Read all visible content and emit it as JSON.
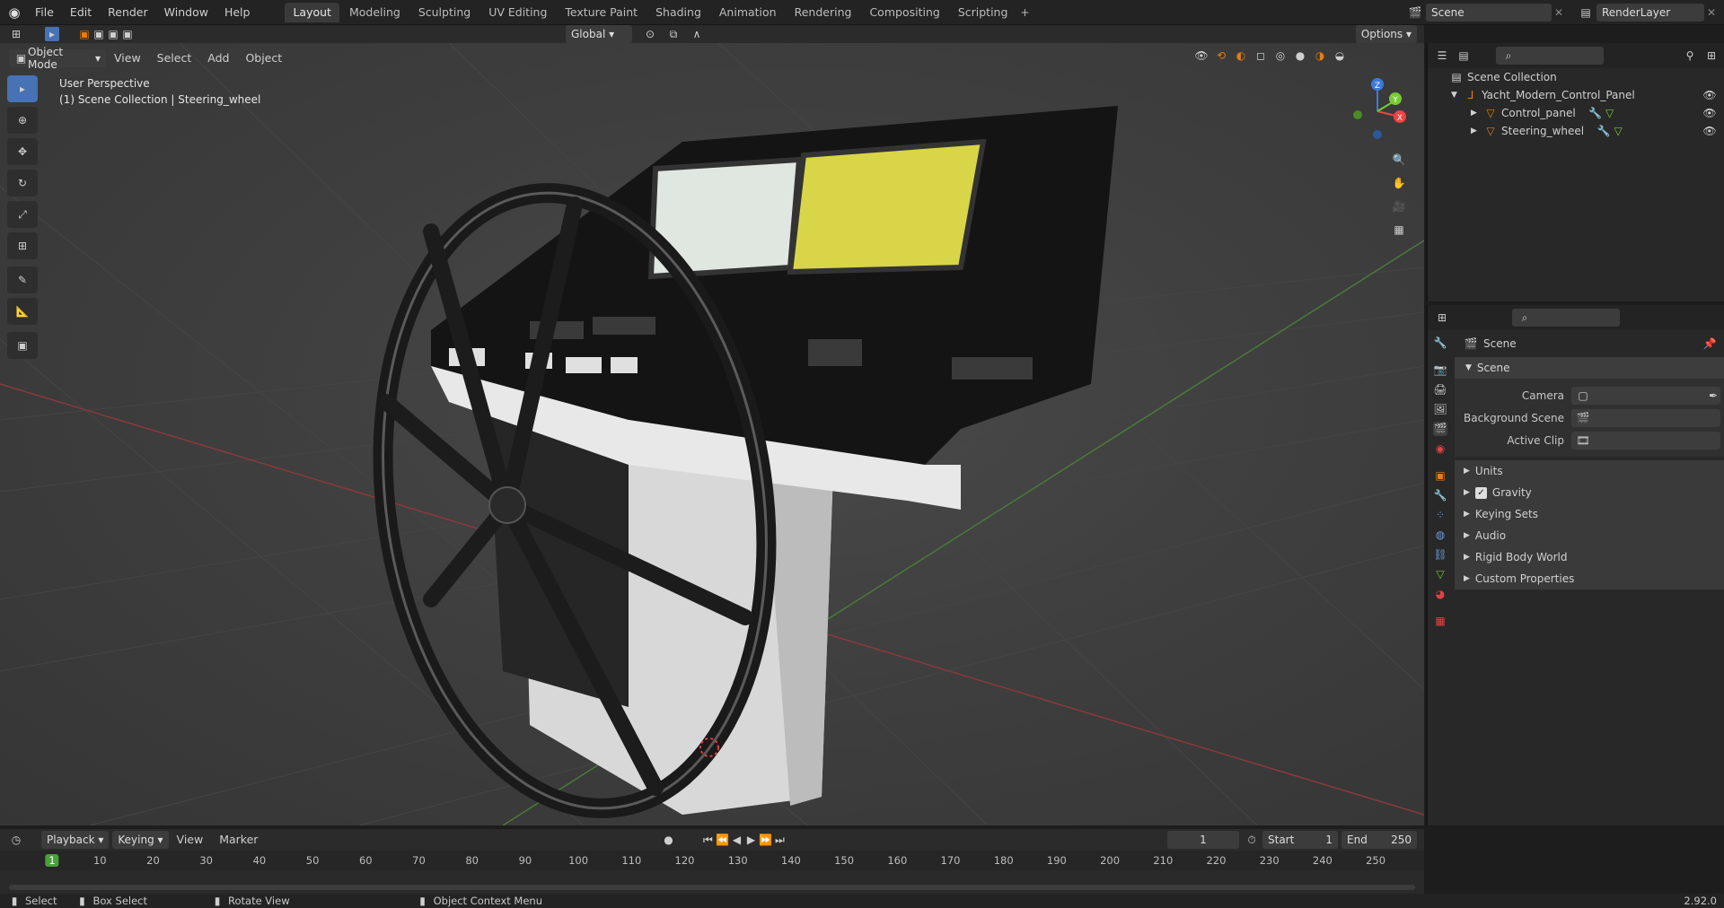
{
  "app": {
    "logo": "blender-logo-icon"
  },
  "menus": [
    "File",
    "Edit",
    "Render",
    "Window",
    "Help"
  ],
  "workspaces": [
    {
      "label": "Layout",
      "active": true
    },
    {
      "label": "Modeling",
      "active": false
    },
    {
      "label": "Sculpting",
      "active": false
    },
    {
      "label": "UV Editing",
      "active": false
    },
    {
      "label": "Texture Paint",
      "active": false
    },
    {
      "label": "Shading",
      "active": false
    },
    {
      "label": "Animation",
      "active": false
    },
    {
      "label": "Rendering",
      "active": false
    },
    {
      "label": "Compositing",
      "active": false
    },
    {
      "label": "Scripting",
      "active": false
    }
  ],
  "topright": {
    "scene": "Scene",
    "render_layer": "RenderLayer"
  },
  "viewport": {
    "mode": "Object Mode",
    "menus": [
      "View",
      "Select",
      "Add",
      "Object"
    ],
    "orientation": "Global",
    "options_label": "Options",
    "overlay_title": "User Perspective",
    "overlay_subtitle": "(1) Scene Collection | Steering_wheel",
    "gizmo": {
      "x": "X",
      "y": "Y",
      "z": "Z"
    }
  },
  "outliner": {
    "root": "Scene Collection",
    "items": [
      {
        "label": "Yacht_Modern_Control_Panel",
        "depth": 1
      },
      {
        "label": "Control_panel",
        "depth": 2
      },
      {
        "label": "Steering_wheel",
        "depth": 2
      }
    ]
  },
  "properties": {
    "header": "Scene",
    "section": "Scene",
    "fields": [
      {
        "label": "Camera"
      },
      {
        "label": "Background Scene"
      },
      {
        "label": "Active Clip"
      }
    ],
    "panels": [
      "Units",
      "Gravity",
      "Keying Sets",
      "Audio",
      "Rigid Body World",
      "Custom Properties"
    ]
  },
  "timeline": {
    "menus": [
      "Playback",
      "Keying",
      "View",
      "Marker"
    ],
    "current_frame": "1",
    "start_label": "Start",
    "start": "1",
    "end_label": "End",
    "end": "250",
    "ticks": [
      "1",
      "10",
      "20",
      "30",
      "40",
      "50",
      "60",
      "70",
      "80",
      "90",
      "100",
      "110",
      "120",
      "130",
      "140",
      "150",
      "160",
      "170",
      "180",
      "190",
      "200",
      "210",
      "220",
      "230",
      "240",
      "250"
    ]
  },
  "statusbar": {
    "select": "Select",
    "box_select": "Box Select",
    "rotate": "Rotate View",
    "context": "Object Context Menu",
    "version": "2.92.0"
  },
  "colors": {
    "accent": "#4772b3",
    "orange": "#e87d0d",
    "header": "#232323",
    "panel": "#282828"
  }
}
